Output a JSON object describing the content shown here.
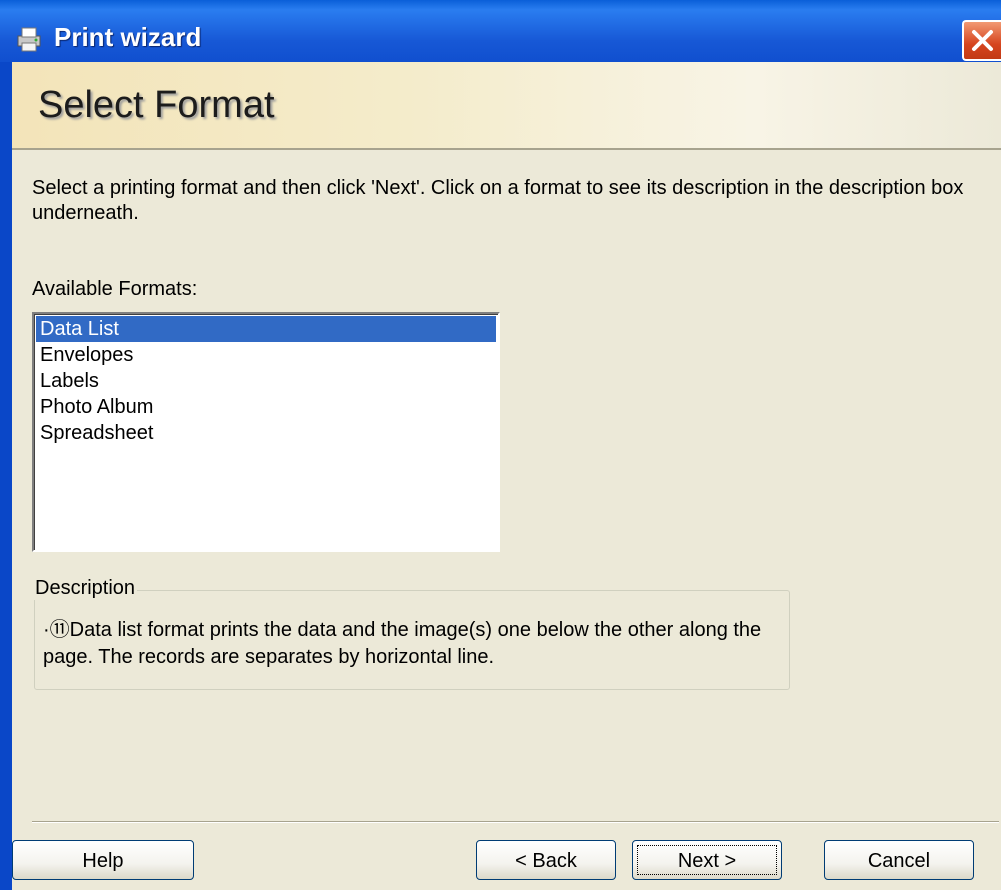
{
  "window": {
    "title": "Print wizard",
    "icon": "printer-icon",
    "close_icon": "close-icon",
    "close_color": "#d6451f"
  },
  "header": {
    "title": "Select Format"
  },
  "instructions": "Select a printing format and then click 'Next'. Click on a format to see its description in the description box underneath.",
  "formats": {
    "label": "Available Formats:",
    "items": [
      "Data List",
      "Envelopes",
      "Labels",
      "Photo Album",
      "Spreadsheet"
    ],
    "selected": "Data List"
  },
  "description": {
    "label": "Description",
    "text": "·⑪Data list format prints the data and the image(s) one below the other along the page. The records are separates by horizontal line."
  },
  "buttons": {
    "help": "Help",
    "back": "< Back",
    "next": "Next >",
    "cancel": "Cancel"
  },
  "colors": {
    "titlebar": "#0a47c8",
    "selection": "#316ac5",
    "dialog_bg": "#ece9d8"
  }
}
